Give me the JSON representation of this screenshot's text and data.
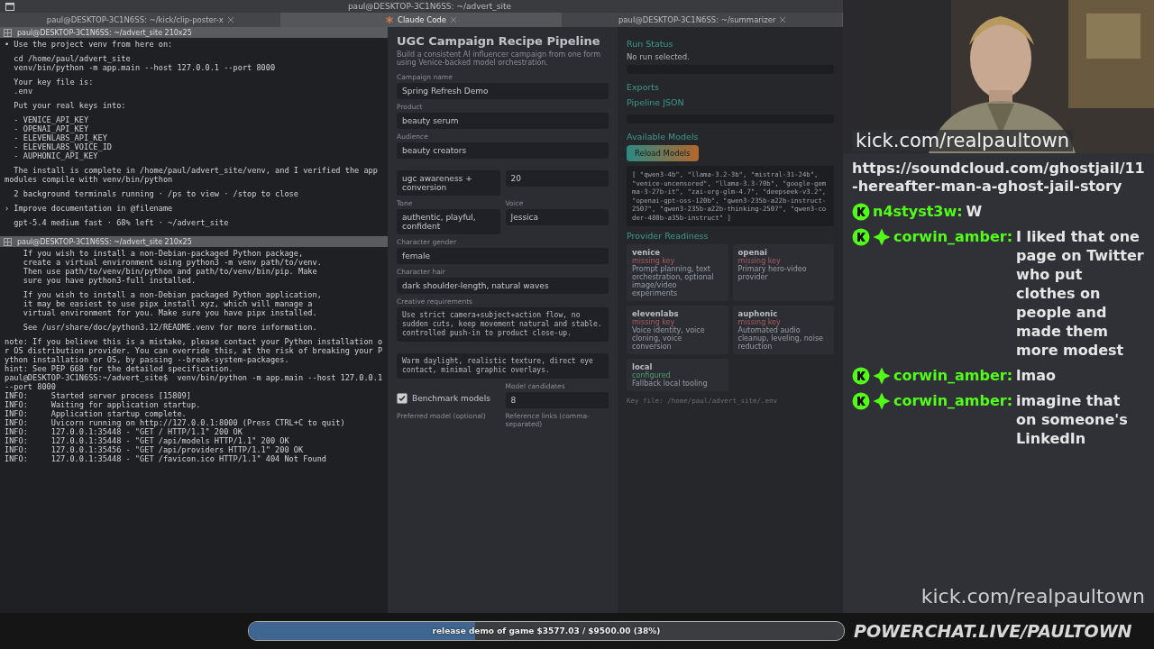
{
  "window": {
    "title": "paul@DESKTOP-3C1N6SS: ~/advert_site"
  },
  "tabs": [
    {
      "label": "paul@DESKTOP-3C1N6SS: ~/kick/clip-poster-x",
      "kind": "shell",
      "selected": false
    },
    {
      "label": "Claude Code",
      "kind": "agent",
      "selected": true
    },
    {
      "label": "paul@DESKTOP-3C1N6SS: ~/summarizer",
      "kind": "shell",
      "selected": false
    }
  ],
  "terminals": [
    {
      "header": "paul@DESKTOP-3C1N6SS: ~/advert_site 210x25",
      "paragraphs": [
        [
          "• Use the project venv from here on:"
        ],
        [
          "  cd /home/paul/advert_site",
          "  venv/bin/python -m app.main --host 127.0.0.1 --port 8000"
        ],
        [
          "  Your key file is:",
          "  .env"
        ],
        [
          "  Put your real keys into:"
        ],
        [
          "  - VENICE_API_KEY",
          "  - OPENAI_API_KEY",
          "  - ELEVENLABS_API_KEY",
          "  - ELEVENLABS_VOICE_ID",
          "  - AUPHONIC_API_KEY"
        ],
        [
          "  The install is complete in /home/paul/advert_site/venv, and I verified the app modules compile with venv/bin/python"
        ],
        [
          "  2 background terminals running · /ps to view · /stop to close"
        ],
        [
          "› Improve documentation in @filename"
        ],
        [
          "  gpt-5.4 medium fast · 68% left · ~/advert_site"
        ]
      ]
    },
    {
      "header": "paul@DESKTOP-3C1N6SS: ~/advert_site 210x25",
      "paragraphs": [
        [
          "    If you wish to install a non-Debian-packaged Python package,",
          "    create a virtual environment using python3 -m venv path/to/venv.",
          "    Then use path/to/venv/bin/python and path/to/venv/bin/pip. Make",
          "    sure you have python3-full installed."
        ],
        [
          "    If you wish to install a non-Debian packaged Python application,",
          "    it may be easiest to use pipx install xyz, which will manage a",
          "    virtual environment for you. Make sure you have pipx installed."
        ],
        [
          "    See /usr/share/doc/python3.12/README.venv for more information."
        ],
        [
          "note: If you believe this is a mistake, please contact your Python installation or OS distribution provider. You can override this, at the risk of breaking your Python installation or OS, by passing --break-system-packages.",
          "hint: See PEP 668 for the detailed specification.",
          "paul@DESKTOP-3C1N6SS:~/advert_site$  venv/bin/python -m app.main --host 127.0.0.1 --port 8000",
          "INFO:     Started server process [15809]",
          "INFO:     Waiting for application startup.",
          "INFO:     Application startup complete.",
          "INFO:     Uvicorn running on http://127.0.0.1:8000 (Press CTRL+C to quit)",
          "INFO:     127.0.0.1:35448 - \"GET / HTTP/1.1\" 200 OK",
          "INFO:     127.0.0.1:35448 - \"GET /api/models HTTP/1.1\" 200 OK",
          "INFO:     127.0.0.1:35456 - \"GET /api/providers HTTP/1.1\" 200 OK",
          "INFO:     127.0.0.1:35448 - \"GET /favicon.ico HTTP/1.1\" 404 Not Found"
        ]
      ]
    }
  ],
  "app": {
    "title": "UGC Campaign Recipe Pipeline",
    "subtitle": "Build a consistent AI influencer campaign from one form using Venice-backed model orchestration.",
    "fields": [
      {
        "kind": "input",
        "label": "Campaign name",
        "value": "Spring Refresh Demo"
      },
      {
        "kind": "input",
        "label": "Product",
        "value": "beauty serum"
      },
      {
        "kind": "input",
        "label": "Audience",
        "value": "beauty creators"
      },
      {
        "kind": "pair",
        "items": [
          {
            "value": "ugc awareness + conversion"
          },
          {
            "value": "20"
          }
        ]
      },
      {
        "kind": "pair",
        "items": [
          {
            "label": "Tone",
            "value": "authentic, playful, confident"
          },
          {
            "label": "Voice",
            "value": "Jessica"
          }
        ]
      },
      {
        "kind": "input",
        "label": "Character gender",
        "value": "female"
      },
      {
        "kind": "input",
        "label": "Character hair",
        "value": "dark shoulder-length, natural waves"
      },
      {
        "kind": "textarea",
        "label": "Creative requirements",
        "value": "Use strict camera+subject+action flow, no sudden cuts, keep movement natural and stable. controlled push-in to product close-up."
      },
      {
        "kind": "textarea",
        "value": "Warm daylight, realistic texture, direct eye contact, minimal graphic overlays."
      },
      {
        "kind": "checkpair",
        "check": {
          "label": "Benchmark models",
          "checked": true
        },
        "input": {
          "label": "Model candidates",
          "value": "8"
        }
      },
      {
        "kind": "labels",
        "items": [
          {
            "label": "Preferred model (optional)"
          },
          {
            "label": "Reference links (comma-separated)"
          }
        ]
      }
    ],
    "run_status": {
      "heading": "Run Status",
      "text": "No run selected."
    },
    "exports": {
      "heading": "Exports",
      "link": "Pipeline JSON"
    },
    "models": {
      "heading": "Available Models",
      "button": "Reload Models",
      "list": "[ \"qwen3-4b\", \"llama-3.2-3b\", \"mistral-31-24b\", \"venice-uncensored\", \"llama-3.3-70b\", \"google-gemma-3-27b-it\", \"zai-org-glm-4.7\", \"deepseek-v3.2\", \"openai-gpt-oss-120b\", \"qwen3-235b-a22b-instruct-2507\", \"qwen3-235b-a22b-thinking-2507\", \"qwen3-coder-480b-a35b-instruct\" ]"
    },
    "providers": {
      "heading": "Provider Readiness",
      "items": [
        {
          "name": "venice",
          "status": "missing key",
          "ready": false,
          "description": "Prompt planning, text orchestration, optional image/video experiments"
        },
        {
          "name": "openai",
          "status": "missing key",
          "ready": false,
          "description": "Primary hero-video provider"
        },
        {
          "name": "elevenlabs",
          "status": "missing key",
          "ready": false,
          "description": "Voice identity, voice cloning, voice conversion"
        },
        {
          "name": "auphonic",
          "status": "missing key",
          "ready": false,
          "description": "Automated audio cleanup, leveling, noise reduction"
        },
        {
          "name": "local",
          "status": "configured",
          "ready": true,
          "description": "Fallback local tooling"
        }
      ],
      "key_file": "Key file: /home/paul/advert_site/.env"
    }
  },
  "chat": {
    "header": "kick.com/realpaultown",
    "messages": [
      {
        "kind": "continuation",
        "text": "https://soundcloud.com/ghostjail/11-hereafter-man-a-ghost-jail-story"
      },
      {
        "kind": "message",
        "user": "n4styst3w:",
        "diamond_badge": false,
        "text": "W"
      },
      {
        "kind": "message",
        "user": "corwin_amber:",
        "diamond_badge": true,
        "text": "I liked that one page on Twitter who put clothes on people and made them more modest"
      },
      {
        "kind": "message",
        "user": "corwin_amber:",
        "diamond_badge": true,
        "text": "lmao"
      },
      {
        "kind": "message",
        "user": "corwin_amber:",
        "diamond_badge": true,
        "text": "imagine that on someone's LinkedIn"
      }
    ],
    "footer": "kick.com/realpaultown"
  },
  "stream_goal": {
    "text": "release demo of game $3577.03 / $9500.00 (38%)",
    "level": 0.38
  },
  "brand": "POWERCHAT.LIVE/PAULTOWN"
}
